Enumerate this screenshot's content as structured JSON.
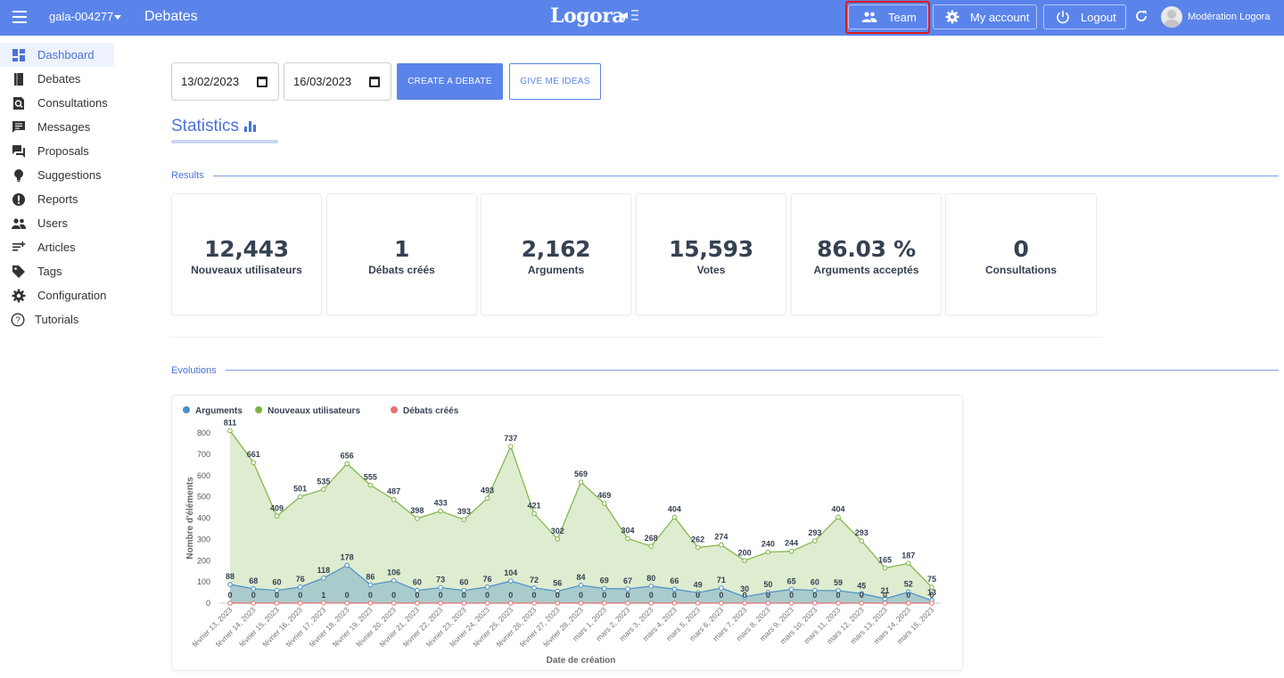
{
  "topbar": {
    "tenant": "gala-004277",
    "section": "Debates",
    "logo": "Logora",
    "team_label": "Team",
    "account_label": "My account",
    "logout_label": "Logout",
    "username": "Modération Logora",
    "icons": [
      "menu-icon",
      "chevron-down-icon",
      "megaphone-icon",
      "group-icon",
      "gear-icon",
      "power-icon",
      "refresh-icon",
      "avatar-icon"
    ]
  },
  "sidebar": {
    "items": [
      {
        "label": "Dashboard",
        "icon": "dashboard-icon",
        "active": true
      },
      {
        "label": "Debates",
        "icon": "book-icon"
      },
      {
        "label": "Consultations",
        "icon": "search-doc-icon"
      },
      {
        "label": "Messages",
        "icon": "message-icon"
      },
      {
        "label": "Proposals",
        "icon": "forum-icon"
      },
      {
        "label": "Suggestions",
        "icon": "lightbulb-icon"
      },
      {
        "label": "Reports",
        "icon": "alert-icon"
      },
      {
        "label": "Users",
        "icon": "users-icon"
      },
      {
        "label": "Articles",
        "icon": "article-add-icon"
      },
      {
        "label": "Tags",
        "icon": "tag-icon"
      },
      {
        "label": "Configuration",
        "icon": "gear-icon"
      },
      {
        "label": "Tutorials",
        "icon": "help-icon"
      }
    ]
  },
  "filters": {
    "start_date": "13/02/2023",
    "end_date": "16/03/2023",
    "create_label": "CREATE A DEBATE",
    "ideas_label": "GIVE ME IDEAS"
  },
  "statistics_title": "Statistics",
  "results_label": "Results",
  "evolutions_label": "Evolutions",
  "cards": [
    {
      "value": "12,443",
      "label": "Nouveaux utilisateurs"
    },
    {
      "value": "1",
      "label": "Débats créés"
    },
    {
      "value": "2,162",
      "label": "Arguments"
    },
    {
      "value": "15,593",
      "label": "Votes"
    },
    {
      "value": "86.03 %",
      "label": "Arguments acceptés"
    },
    {
      "value": "0",
      "label": "Consultations"
    }
  ],
  "colors": {
    "primary": "#5b84eb",
    "arguments": "#4a90c6",
    "users": "#7cb342",
    "debates": "#e57373"
  },
  "chart_data": {
    "type": "area",
    "xlabel": "Date de création",
    "ylabel": "Nombre d'éléments",
    "ylim": [
      0,
      800
    ],
    "yticks": [
      0,
      100,
      200,
      300,
      400,
      500,
      600,
      700,
      800
    ],
    "legend": "top-left",
    "categories": [
      "février 13, 2023",
      "février 14, 2023",
      "février 15, 2023",
      "février 16, 2023",
      "février 17, 2023",
      "février 18, 2023",
      "février 19, 2023",
      "février 20, 2023",
      "février 21, 2023",
      "février 22, 2023",
      "février 23, 2023",
      "février 24, 2023",
      "février 25, 2023",
      "février 26, 2023",
      "février 27, 2023",
      "février 28, 2023",
      "mars 1, 2023",
      "mars 2, 2023",
      "mars 3, 2023",
      "mars 4, 2023",
      "mars 5, 2023",
      "mars 6, 2023",
      "mars 7, 2023",
      "mars 8, 2023",
      "mars 9, 2023",
      "mars 10, 2023",
      "mars 11, 2023",
      "mars 12, 2023",
      "mars 13, 2023",
      "mars 14, 2023",
      "mars 15, 2023"
    ],
    "series": [
      {
        "name": "Arguments",
        "color": "#4a90c6",
        "values": [
          88,
          68,
          60,
          76,
          118,
          178,
          86,
          106,
          60,
          73,
          60,
          76,
          104,
          72,
          56,
          84,
          69,
          67,
          80,
          66,
          49,
          71,
          30,
          50,
          65,
          60,
          59,
          45,
          21,
          52,
          13
        ]
      },
      {
        "name": "Nouveaux utilisateurs",
        "color": "#7cb342",
        "values": [
          811,
          661,
          409,
          501,
          535,
          656,
          555,
          487,
          398,
          433,
          393,
          493,
          737,
          421,
          302,
          569,
          469,
          304,
          268,
          404,
          262,
          274,
          200,
          240,
          244,
          293,
          404,
          293,
          165,
          187,
          75
        ]
      },
      {
        "name": "Débats créés",
        "color": "#e57373",
        "values": [
          0,
          0,
          0,
          0,
          1,
          0,
          0,
          0,
          0,
          0,
          0,
          0,
          0,
          0,
          0,
          0,
          0,
          0,
          0,
          0,
          0,
          0,
          0,
          0,
          0,
          0,
          0,
          0,
          0,
          0,
          0
        ]
      }
    ]
  }
}
